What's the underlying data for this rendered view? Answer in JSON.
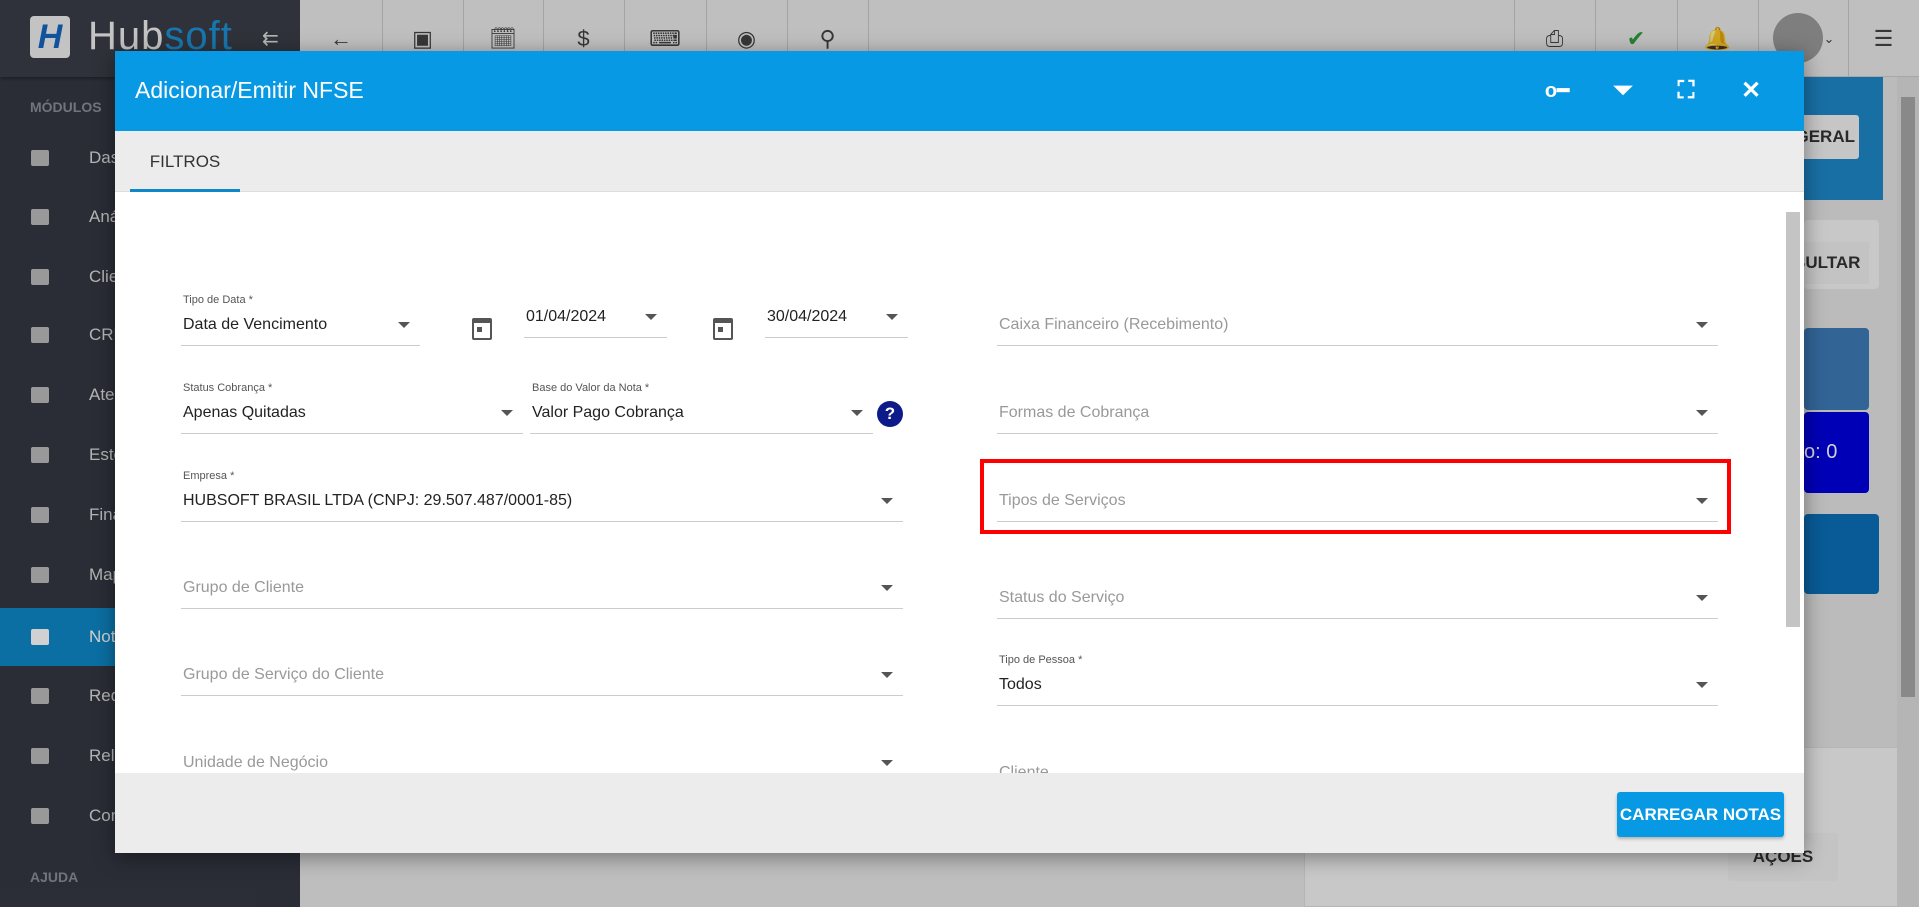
{
  "app": {
    "logo_prefix": "Hub",
    "logo_suffix": "soft",
    "logo_mark": "H"
  },
  "sidebar": {
    "section_modules": "MÓDULOS",
    "section_help": "AJUDA",
    "items": [
      {
        "label": "Dashboard"
      },
      {
        "label": "Análises"
      },
      {
        "label": "Clientes"
      },
      {
        "label": "CRM"
      },
      {
        "label": "Atendimentos"
      },
      {
        "label": "Estoque"
      },
      {
        "label": "Financeiro"
      },
      {
        "label": "Mapeamento"
      },
      {
        "label": "Nota Fiscal"
      },
      {
        "label": "Rede"
      },
      {
        "label": "Relatórios"
      },
      {
        "label": "Configurações"
      }
    ]
  },
  "background": {
    "geral_button": "GERAL",
    "consultar_button": "SULTAR",
    "counter_text": "o: 0",
    "acoes_button": "AÇÕES"
  },
  "modal": {
    "title": "Adicionar/Emitir NFSE",
    "tab": "FILTROS",
    "load_button": "CARREGAR NOTAS",
    "fields": {
      "tipo_data": {
        "label": "Tipo de Data *",
        "value": "Data de Vencimento"
      },
      "date_start": {
        "value": "01/04/2024"
      },
      "date_end": {
        "value": "30/04/2024"
      },
      "status_cobranca": {
        "label": "Status Cobrança *",
        "value": "Apenas Quitadas"
      },
      "base_valor": {
        "label": "Base do Valor da Nota *",
        "value": "Valor Pago Cobrança"
      },
      "help": "?",
      "empresa": {
        "label": "Empresa *",
        "value": "HUBSOFT BRASIL LTDA (CNPJ: 29.507.487/0001-85)"
      },
      "grupo_cliente": {
        "placeholder": "Grupo de Cliente"
      },
      "grupo_servico": {
        "placeholder": "Grupo de Serviço do Cliente"
      },
      "unidade_negocio": {
        "placeholder": "Unidade de Negócio"
      },
      "caixa": {
        "placeholder": "Caixa Financeiro (Recebimento)"
      },
      "formas": {
        "placeholder": "Formas de Cobrança"
      },
      "tipos_servicos": {
        "placeholder": "Tipos de Serviços"
      },
      "status_servico": {
        "placeholder": "Status do Serviço"
      },
      "tipo_pessoa": {
        "label": "Tipo de Pessoa *",
        "value": "Todos"
      },
      "cliente": {
        "placeholder": "Cliente"
      }
    }
  },
  "colors": {
    "primary": "#0799e3",
    "highlight": "#ff0000",
    "sidebar": "#343842",
    "active": "#0e88c7"
  }
}
